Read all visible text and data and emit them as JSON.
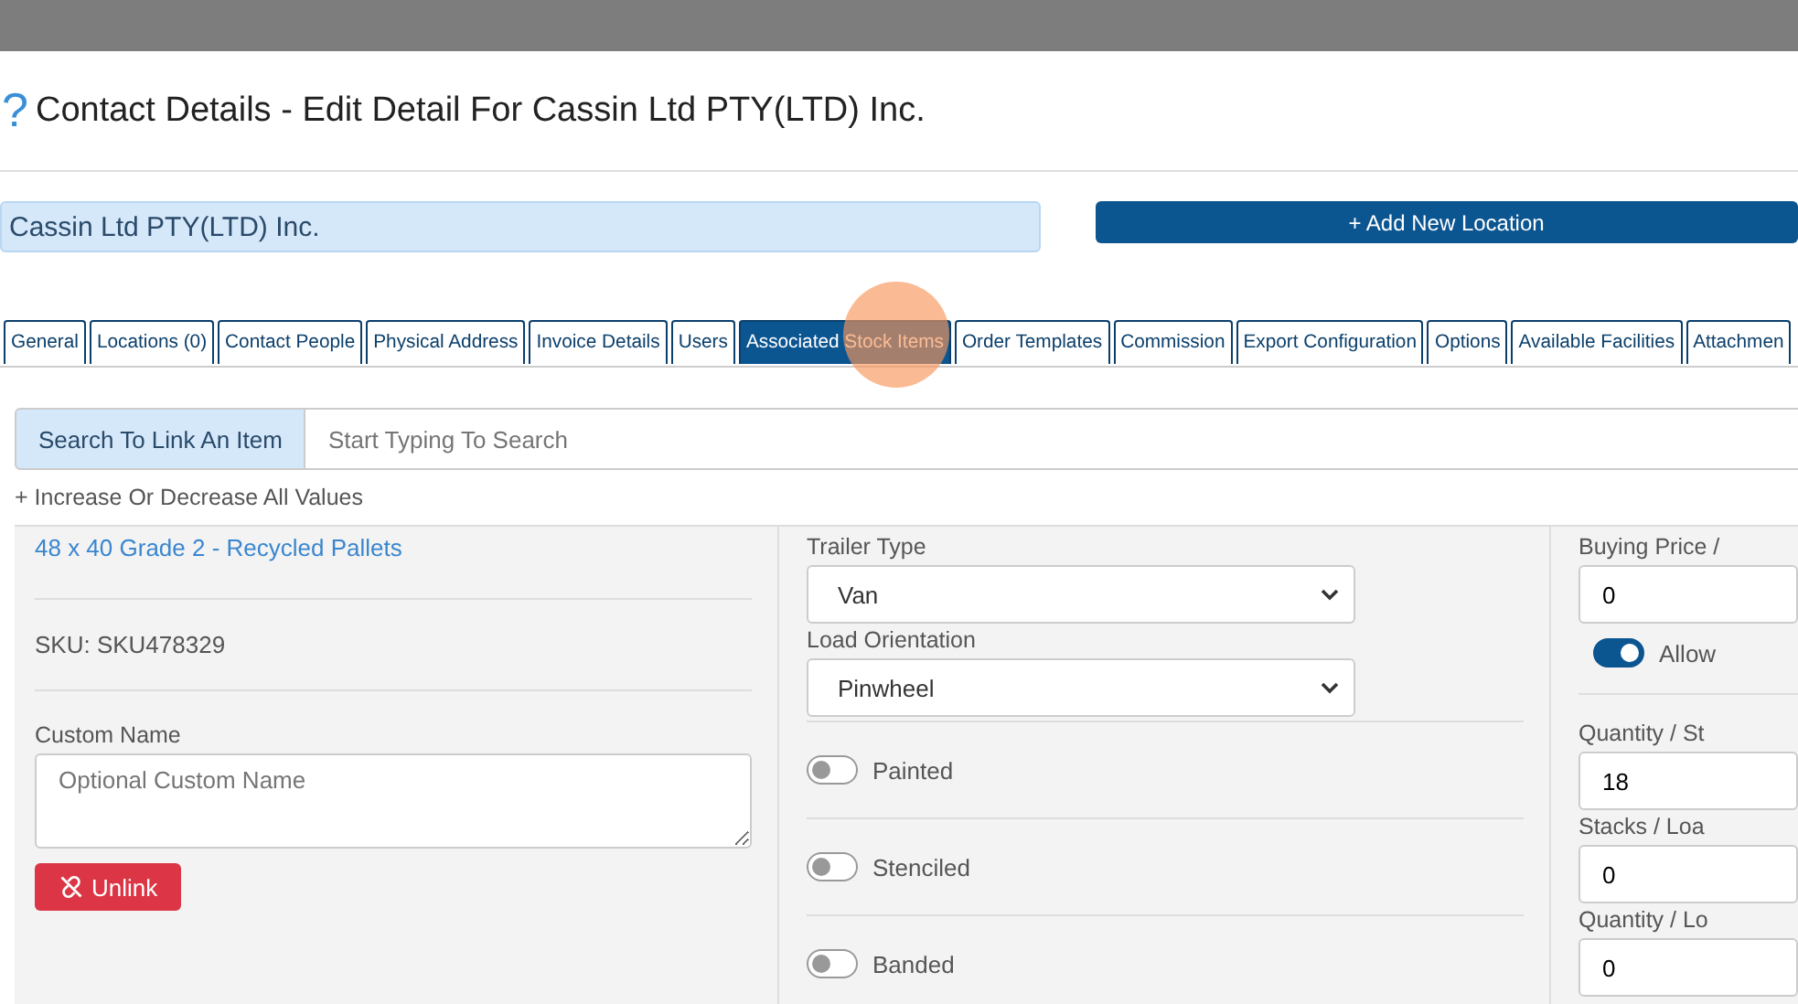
{
  "title": "Contact Details - Edit Detail For Cassin Ltd PTY(LTD) Inc.",
  "help_glyph": "?",
  "name_field": {
    "value": "Cassin Ltd PTY(LTD) Inc."
  },
  "add_location_button": "+ Add New Location",
  "tabs": [
    {
      "label": "General",
      "selected": false
    },
    {
      "label": "Locations (0)",
      "selected": false
    },
    {
      "label": "Contact People",
      "selected": false
    },
    {
      "label": "Physical Address",
      "selected": false
    },
    {
      "label": "Invoice Details",
      "selected": false
    },
    {
      "label": "Users",
      "selected": false
    },
    {
      "label": "Associated Stock Items",
      "selected": true
    },
    {
      "label": "Order Templates",
      "selected": false
    },
    {
      "label": "Commission",
      "selected": false
    },
    {
      "label": "Export Configuration",
      "selected": false
    },
    {
      "label": "Options",
      "selected": false
    },
    {
      "label": "Available Facilities",
      "selected": false
    },
    {
      "label": "Attachmen",
      "selected": false
    }
  ],
  "search": {
    "label": "Search To Link An Item",
    "placeholder": "Start Typing To Search"
  },
  "adjust_all": "+ Increase Or Decrease All Values",
  "item": {
    "link": "48 x 40 Grade 2 - Recycled Pallets",
    "sku": "SKU: SKU478329",
    "custom_name_label": "Custom Name",
    "custom_name_placeholder": "Optional Custom Name",
    "unlink_button": "Unlink"
  },
  "selects": [
    {
      "label": "Trailer Type",
      "value": "Van"
    },
    {
      "label": "Load Orientation",
      "value": "Pinwheel"
    }
  ],
  "toggles": [
    {
      "label": "Painted",
      "on": false
    },
    {
      "label": "Stenciled",
      "on": false
    },
    {
      "label": "Banded",
      "on": false
    }
  ],
  "right_column": [
    {
      "kind": "input",
      "label": "Buying Price /",
      "value": "0"
    },
    {
      "kind": "toggle",
      "label": "Allow",
      "on": true
    },
    {
      "kind": "input",
      "label": "Quantity / St",
      "value": "18"
    },
    {
      "kind": "input",
      "label": "Stacks / Loa",
      "value": "0"
    },
    {
      "kind": "input",
      "label": "Quantity / Lo",
      "value": "0"
    }
  ]
}
